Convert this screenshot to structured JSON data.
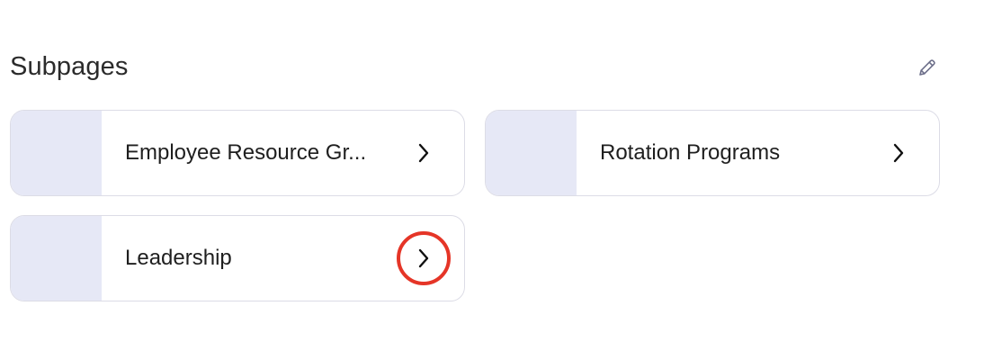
{
  "section": {
    "title": "Subpages",
    "edit_icon": "pencil-icon"
  },
  "subpages": [
    {
      "label": "Employee Resource Gr...",
      "chevron_icon": "chevron-right-icon",
      "highlighted": false
    },
    {
      "label": "Rotation Programs",
      "chevron_icon": "chevron-right-icon",
      "highlighted": false
    },
    {
      "label": "Leadership",
      "chevron_icon": "chevron-right-icon",
      "highlighted": true
    }
  ],
  "colors": {
    "thumbnail": "#e6e8f6",
    "card_border": "#dcdce6",
    "highlight_ring": "#e53527",
    "text": "#1f1f1f"
  }
}
